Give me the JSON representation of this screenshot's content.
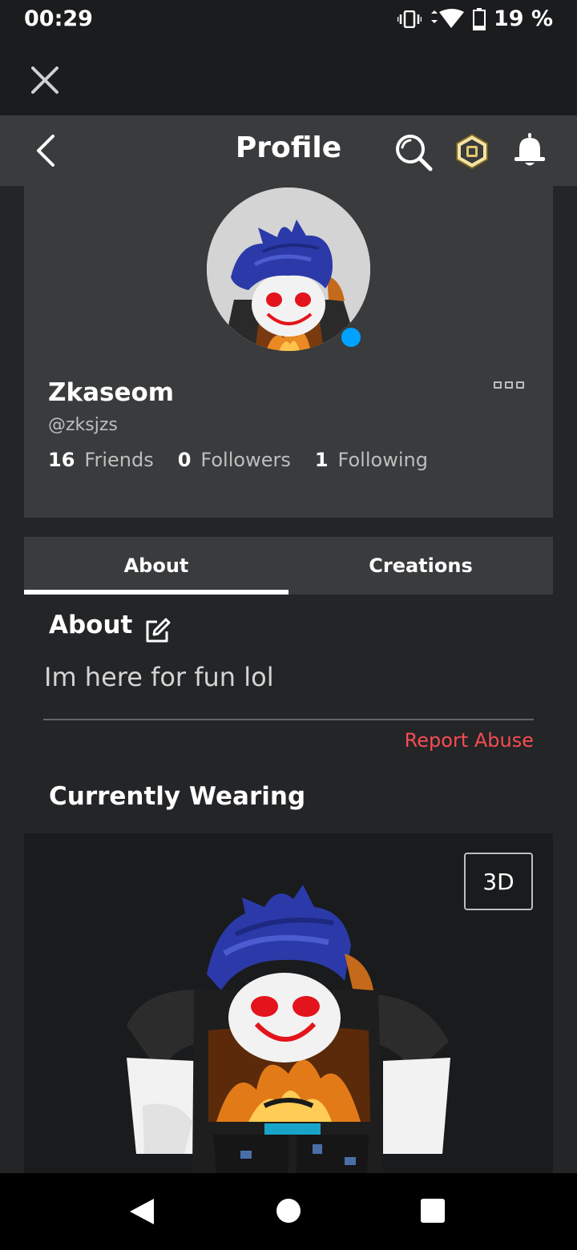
{
  "status_bar": {
    "time": "00:29",
    "battery": "19 %",
    "icons": [
      "vibrate-icon",
      "wifi-icon",
      "battery-icon"
    ]
  },
  "header": {
    "title": "Profile",
    "icons": [
      "back-icon",
      "search-icon",
      "robux-icon",
      "bell-icon"
    ]
  },
  "profile": {
    "display_name": "Zkaseom",
    "username": "@zksjzs",
    "online": true,
    "stats": [
      {
        "count": "16",
        "label": "Friends"
      },
      {
        "count": "0",
        "label": "Followers"
      },
      {
        "count": "1",
        "label": "Following"
      }
    ]
  },
  "tabs": [
    {
      "label": "About",
      "active": true
    },
    {
      "label": "Creations",
      "active": false
    }
  ],
  "about": {
    "heading": "About",
    "text": "Im here for fun lol",
    "report_label": "Report Abuse"
  },
  "wearing": {
    "heading": "Currently Wearing",
    "view_toggle_label": "3D"
  },
  "colors": {
    "background": "#232527",
    "card": "#393b3d",
    "accent_online": "#00a2ff",
    "report": "#f74b52",
    "hair": "#2b3aa8"
  }
}
